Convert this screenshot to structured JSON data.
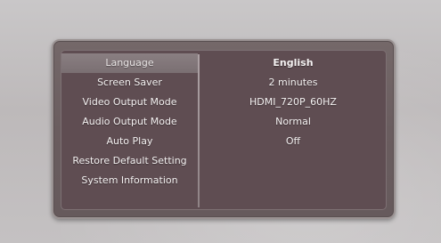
{
  "settings_menu": {
    "items": [
      {
        "label": "Language",
        "value": "English"
      },
      {
        "label": "Screen Saver",
        "value": "2 minutes"
      },
      {
        "label": "Video Output Mode",
        "value": "HDMI_720P_60HZ"
      },
      {
        "label": "Audio Output Mode",
        "value": "Normal"
      },
      {
        "label": "Auto Play",
        "value": "Off"
      },
      {
        "label": "Restore Default Setting",
        "value": ""
      },
      {
        "label": "System Information",
        "value": ""
      }
    ]
  },
  "colors": {
    "background": "#c4c1c2",
    "panel": "#5f4d52",
    "selected_row": "#857a7d",
    "text": "#f4f1f1"
  }
}
